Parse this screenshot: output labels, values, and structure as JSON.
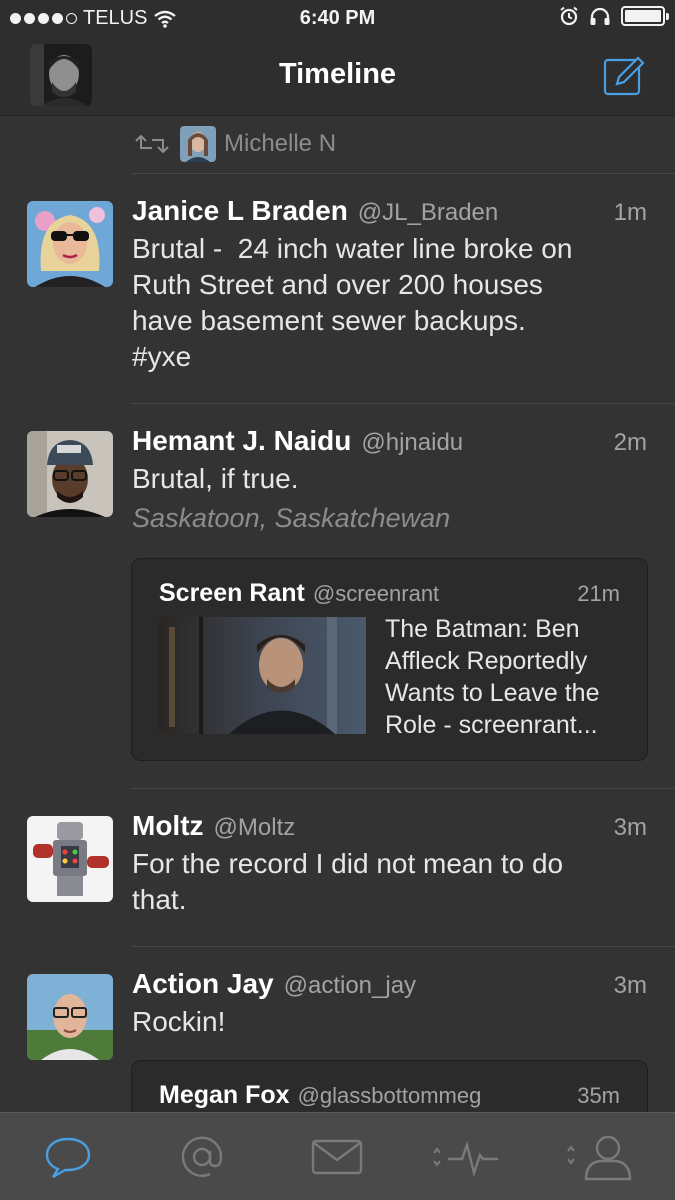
{
  "status_bar": {
    "carrier": "TELUS",
    "time": "6:40 PM",
    "icons": [
      "signal-dots-icon",
      "wifi-icon",
      "alarm-icon",
      "headphones-icon",
      "battery-icon"
    ]
  },
  "nav": {
    "title": "Timeline",
    "compose_icon": "compose-icon",
    "avatar_icon": "profile-avatar"
  },
  "retweet": {
    "icon": "retweet-icon",
    "name": "Michelle N"
  },
  "tweets": [
    {
      "name": "Janice L Braden",
      "handle": "@JL_Braden",
      "time": "1m",
      "text": [
        "Brutal -  24 inch water line broke on",
        "Ruth Street and over 200 houses",
        "have basement sewer backups.",
        "#yxe"
      ]
    },
    {
      "name": "Hemant J. Naidu",
      "handle": "@hjnaidu",
      "time": "2m",
      "text": [
        "Brutal, if true."
      ],
      "location": "Saskatoon, Saskatchewan",
      "quote": {
        "name": "Screen Rant",
        "handle": "@screenrant",
        "time": "21m",
        "text": [
          "The Batman: Ben",
          "Affleck Reportedly",
          "Wants to Leave the",
          "Role - screenrant..."
        ]
      }
    },
    {
      "name": "Moltz",
      "handle": "@Moltz",
      "time": "3m",
      "text": [
        "For the record I did not mean to do",
        "that."
      ]
    },
    {
      "name": "Action Jay",
      "handle": "@action_jay",
      "time": "3m",
      "text": [
        "Rockin!"
      ],
      "quote": {
        "name": "Megan Fox",
        "handle": "@glassbottommeg",
        "time": "35m"
      }
    }
  ],
  "tab_bar": {
    "tabs": [
      {
        "icon": "chat-bubble-icon",
        "active": true
      },
      {
        "icon": "mentions-at-icon",
        "active": false
      },
      {
        "icon": "messages-envelope-icon",
        "active": false
      },
      {
        "icon": "activity-pulse-icon",
        "active": false
      },
      {
        "icon": "profile-person-icon",
        "active": false
      }
    ],
    "active_color": "#4a9fe0",
    "inactive_color": "#7a7a7a"
  },
  "colors": {
    "background": "#333333",
    "bars": "#2e2e2e",
    "accent": "#4a9fe0"
  }
}
